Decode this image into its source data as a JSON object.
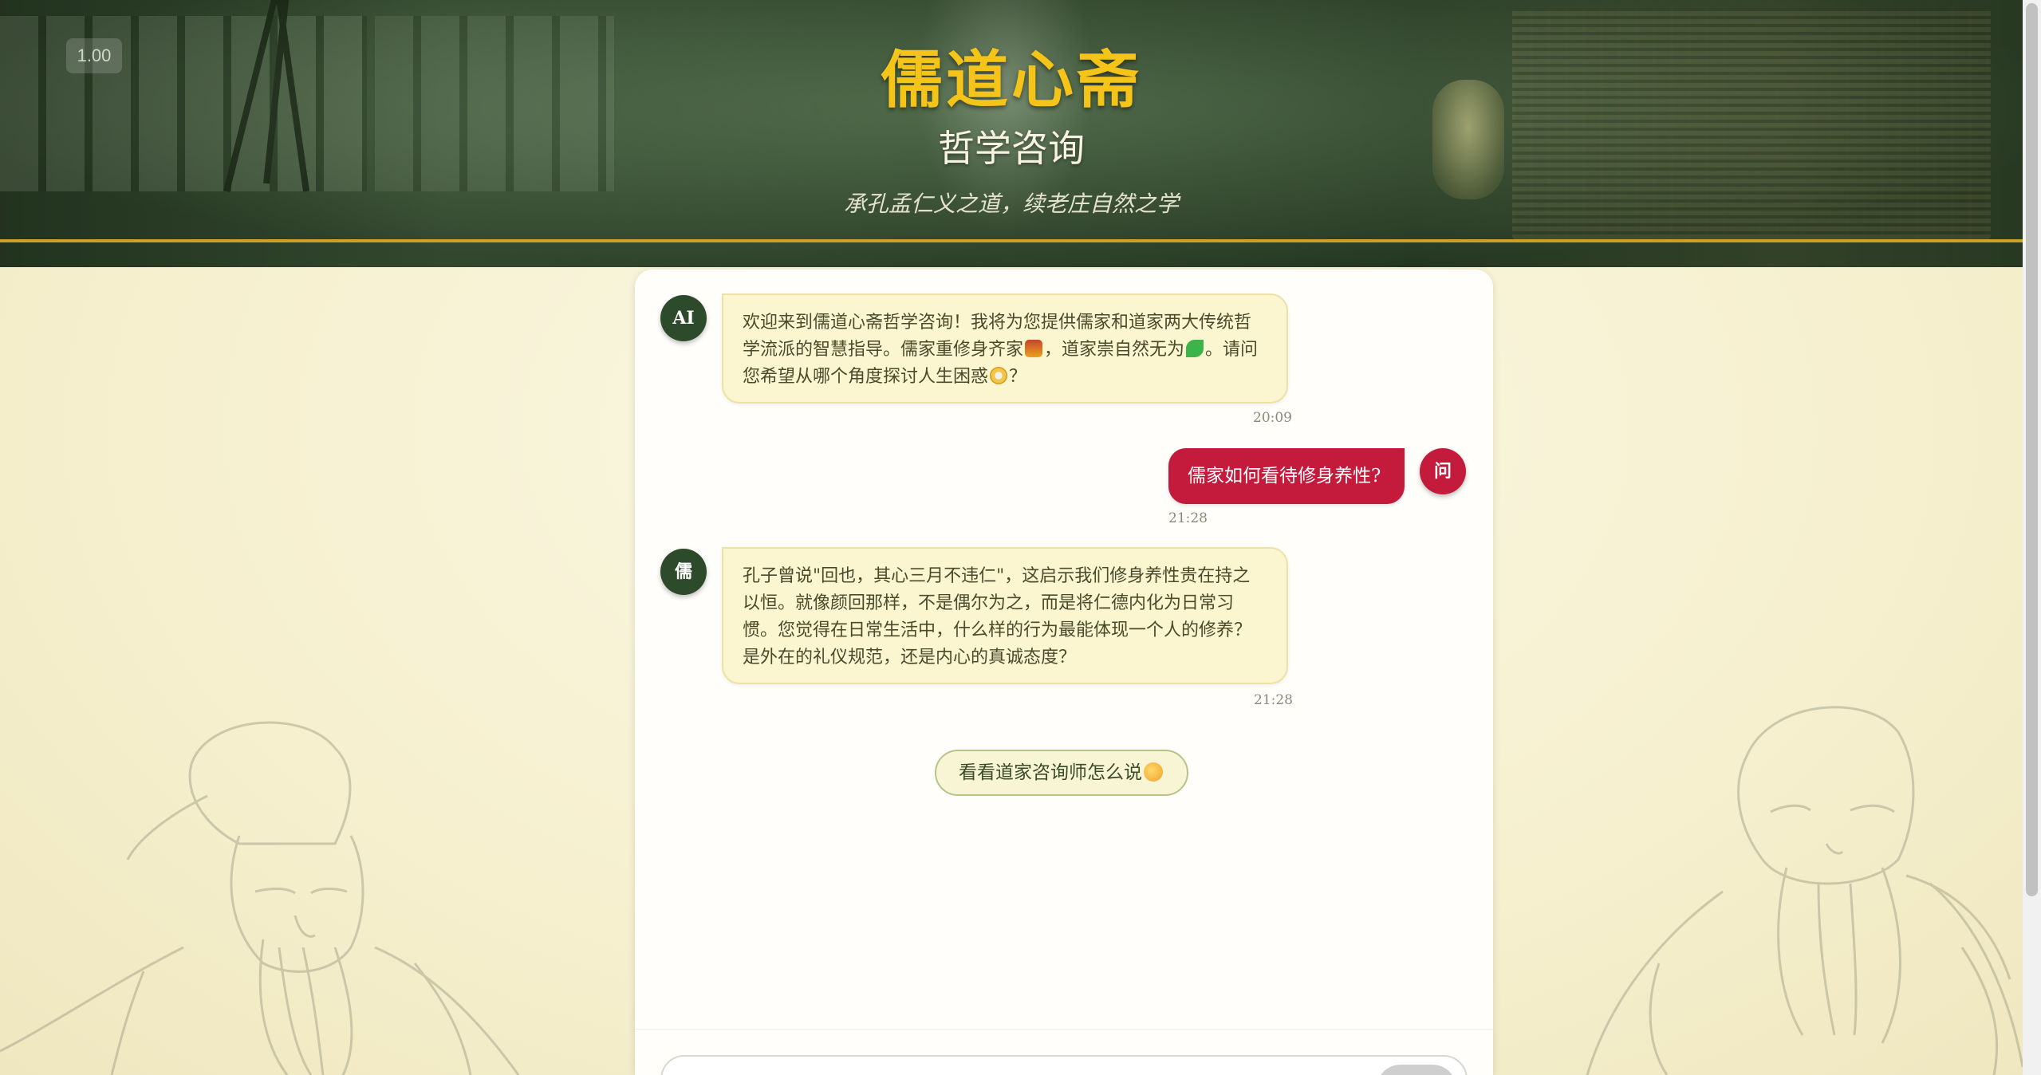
{
  "header": {
    "zoom_badge": "1.00",
    "title": "儒道心斋",
    "subtitle": "哲学咨询",
    "tagline": "承孔孟仁义之道，续老庄自然之学"
  },
  "messages": [
    {
      "role": "bot",
      "avatar": "AI",
      "parts": [
        "欢迎来到儒道心斋哲学咨询！我将为您提供儒家和道家两大传统哲学流派的智慧指导。儒家重修身齐家",
        "，道家崇自然无为",
        "。请问您希望从哪个角度探讨人生困惑",
        "？"
      ],
      "emojis": [
        "scroll-emoji",
        "leaf-emoji",
        "thinking-emoji"
      ],
      "time": "20:09"
    },
    {
      "role": "user",
      "avatar": "问",
      "text": "儒家如何看待修身养性?",
      "time": "21:28"
    },
    {
      "role": "bot",
      "avatar": "儒",
      "text": "孔子曾说\"回也，其心三月不违仁\"，这启示我们修身养性贵在持之以恒。就像颜回那样，不是偶尔为之，而是将仁德内化为日常习惯。您觉得在日常生活中，什么样的行为最能体现一个人的修养？是外在的礼仪规范，还是内心的真诚态度？",
      "time": "21:28"
    }
  ],
  "daoist_button": {
    "label": "看看道家咨询师怎么说",
    "icon": "thinking-face-emoji"
  },
  "input": {
    "placeholder": ""
  },
  "colors": {
    "header_gold": "#f4c419",
    "user_bubble": "#c41a3c",
    "bot_avatar": "#2d4a2a"
  }
}
